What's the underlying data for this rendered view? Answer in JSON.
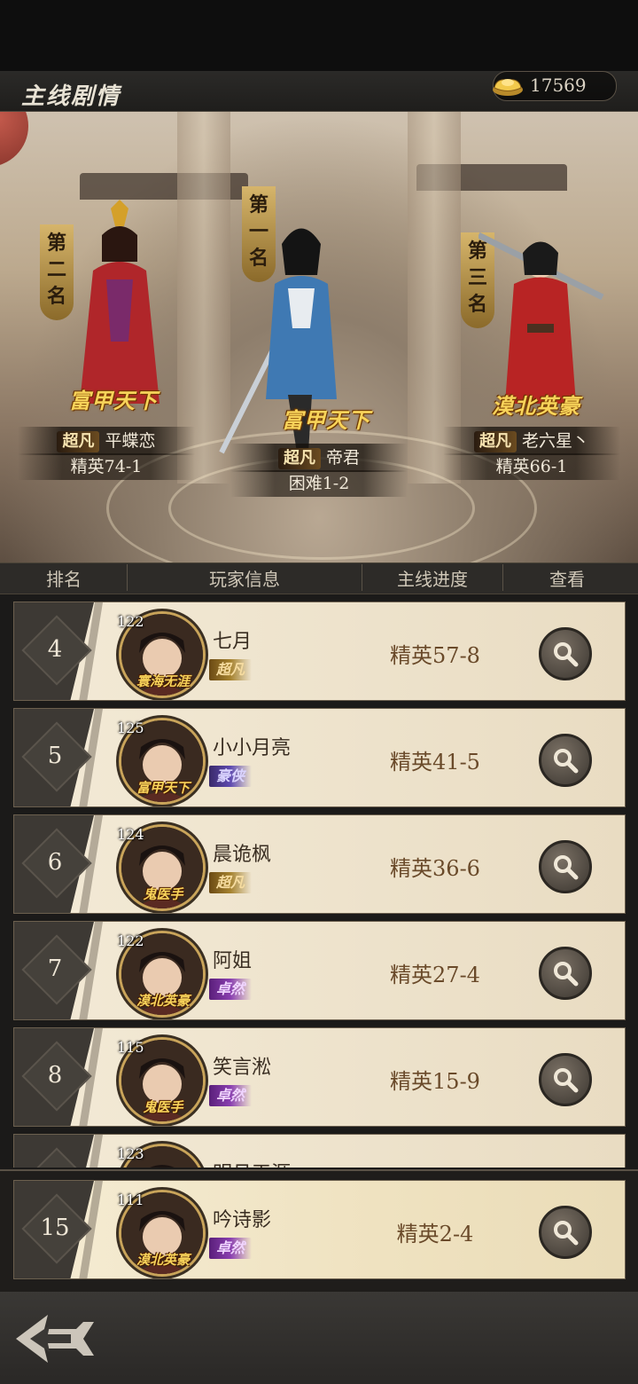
{
  "header": {
    "title": "主线剧情",
    "currency": {
      "icon": "gold-ingot-icon",
      "amount": "17569"
    }
  },
  "podium": [
    {
      "rank_label": "第二名",
      "badge": "富甲天下",
      "tag": "超凡",
      "name": "平蝶恋",
      "progress": "精英74-1"
    },
    {
      "rank_label": "第一名",
      "badge": "富甲天下",
      "tag": "超凡",
      "name": "帝君",
      "progress": "困难1-2"
    },
    {
      "rank_label": "第三名",
      "badge": "漠北英豪",
      "tag": "超凡",
      "name": "老六星丶",
      "progress": "精英66-1"
    }
  ],
  "columns": {
    "rank": "排名",
    "player": "玩家信息",
    "progress": "主线进度",
    "view": "查看"
  },
  "rows": [
    {
      "rank": "4",
      "level": "122",
      "badge": "寰海无涯",
      "name": "七月",
      "tag": "超凡",
      "tag_style": "gold",
      "progress": "精英57-8"
    },
    {
      "rank": "5",
      "level": "125",
      "badge": "富甲天下",
      "name": "小小月亮",
      "tag": "豪侠",
      "tag_style": "hero",
      "progress": "精英41-5"
    },
    {
      "rank": "6",
      "level": "124",
      "badge": "鬼医手",
      "name": "晨诡枫",
      "tag": "超凡",
      "tag_style": "gold",
      "progress": "精英36-6"
    },
    {
      "rank": "7",
      "level": "122",
      "badge": "漠北英豪",
      "name": "阿姐",
      "tag": "卓然",
      "tag_style": "purple",
      "progress": "精英27-4"
    },
    {
      "rank": "8",
      "level": "115",
      "badge": "鬼医手",
      "name": "笑言淞",
      "tag": "卓然",
      "tag_style": "purple",
      "progress": "精英15-9"
    },
    {
      "rank": "",
      "level": "123",
      "badge": "",
      "name": "明月天涯",
      "tag": "",
      "tag_style": "gold",
      "progress": ""
    }
  ],
  "my_row": {
    "rank": "15",
    "level": "111",
    "badge": "漠北英豪",
    "name": "吟诗影",
    "tag": "卓然",
    "tag_style": "purple",
    "progress": "精英2-4"
  },
  "footer": {
    "back_icon": "back-arrow-icon"
  }
}
